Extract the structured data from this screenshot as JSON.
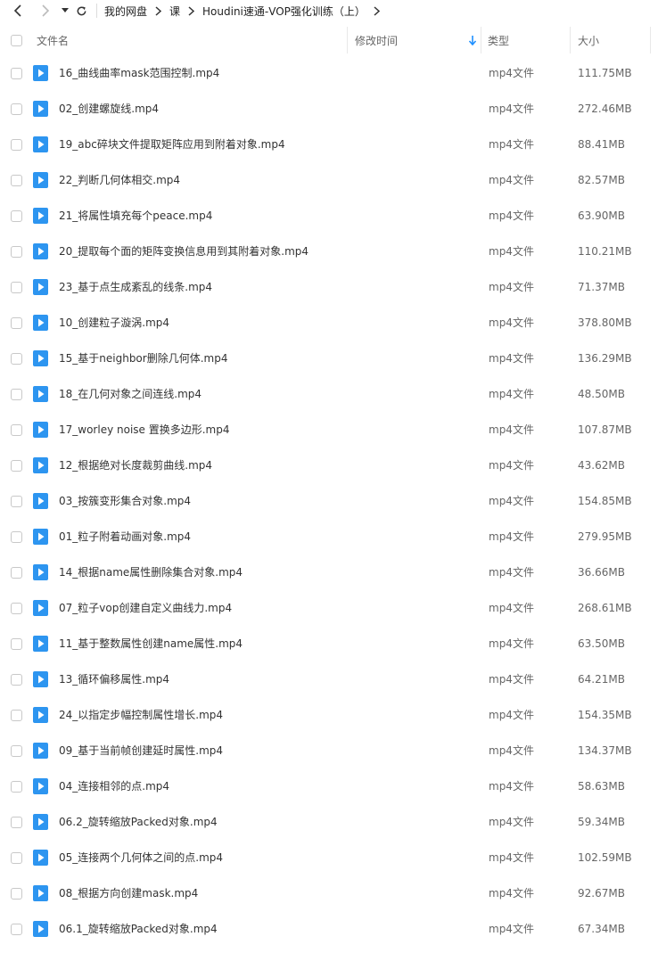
{
  "breadcrumb": {
    "items": [
      "我的网盘",
      "课",
      "Houdini速通-VOP强化训练（上）"
    ]
  },
  "columns": {
    "name": "文件名",
    "modified": "修改时间",
    "type": "类型",
    "size": "大小"
  },
  "sort": {
    "column": "modified",
    "direction": "descending"
  },
  "colors": {
    "accent": "#1e90ff",
    "icon_fill": "#2d95f0"
  },
  "files": [
    {
      "name": "16_曲线曲率mask范围控制.mp4",
      "type": "mp4文件",
      "size": "111.75MB"
    },
    {
      "name": "02_创建螺旋线.mp4",
      "type": "mp4文件",
      "size": "272.46MB"
    },
    {
      "name": "19_abc碎块文件提取矩阵应用到附着对象.mp4",
      "type": "mp4文件",
      "size": "88.41MB"
    },
    {
      "name": "22_判断几何体相交.mp4",
      "type": "mp4文件",
      "size": "82.57MB"
    },
    {
      "name": "21_将属性填充每个peace.mp4",
      "type": "mp4文件",
      "size": "63.90MB"
    },
    {
      "name": "20_提取每个面的矩阵变换信息用到其附着对象.mp4",
      "type": "mp4文件",
      "size": "110.21MB"
    },
    {
      "name": "23_基于点生成紊乱的线条.mp4",
      "type": "mp4文件",
      "size": "71.37MB"
    },
    {
      "name": "10_创建粒子漩涡.mp4",
      "type": "mp4文件",
      "size": "378.80MB"
    },
    {
      "name": "15_基于neighbor删除几何体.mp4",
      "type": "mp4文件",
      "size": "136.29MB"
    },
    {
      "name": "18_在几何对象之间连线.mp4",
      "type": "mp4文件",
      "size": "48.50MB"
    },
    {
      "name": "17_worley noise 置换多边形.mp4",
      "type": "mp4文件",
      "size": "107.87MB"
    },
    {
      "name": "12_根据绝对长度裁剪曲线.mp4",
      "type": "mp4文件",
      "size": "43.62MB"
    },
    {
      "name": "03_按簇变形集合对象.mp4",
      "type": "mp4文件",
      "size": "154.85MB"
    },
    {
      "name": "01_粒子附着动画对象.mp4",
      "type": "mp4文件",
      "size": "279.95MB"
    },
    {
      "name": "14_根据name属性删除集合对象.mp4",
      "type": "mp4文件",
      "size": "36.66MB"
    },
    {
      "name": "07_粒子vop创建自定义曲线力.mp4",
      "type": "mp4文件",
      "size": "268.61MB"
    },
    {
      "name": "11_基于整数属性创建name属性.mp4",
      "type": "mp4文件",
      "size": "63.50MB"
    },
    {
      "name": "13_循环偏移属性.mp4",
      "type": "mp4文件",
      "size": "64.21MB"
    },
    {
      "name": "24_以指定步幅控制属性增长.mp4",
      "type": "mp4文件",
      "size": "154.35MB"
    },
    {
      "name": "09_基于当前帧创建延时属性.mp4",
      "type": "mp4文件",
      "size": "134.37MB"
    },
    {
      "name": "04_连接相邻的点.mp4",
      "type": "mp4文件",
      "size": "58.63MB"
    },
    {
      "name": "06.2_旋转缩放Packed对象.mp4",
      "type": "mp4文件",
      "size": "59.34MB"
    },
    {
      "name": "05_连接两个几何体之间的点.mp4",
      "type": "mp4文件",
      "size": "102.59MB"
    },
    {
      "name": "08_根据方向创建mask.mp4",
      "type": "mp4文件",
      "size": "92.67MB"
    },
    {
      "name": "06.1_旋转缩放Packed对象.mp4",
      "type": "mp4文件",
      "size": "67.34MB"
    }
  ]
}
